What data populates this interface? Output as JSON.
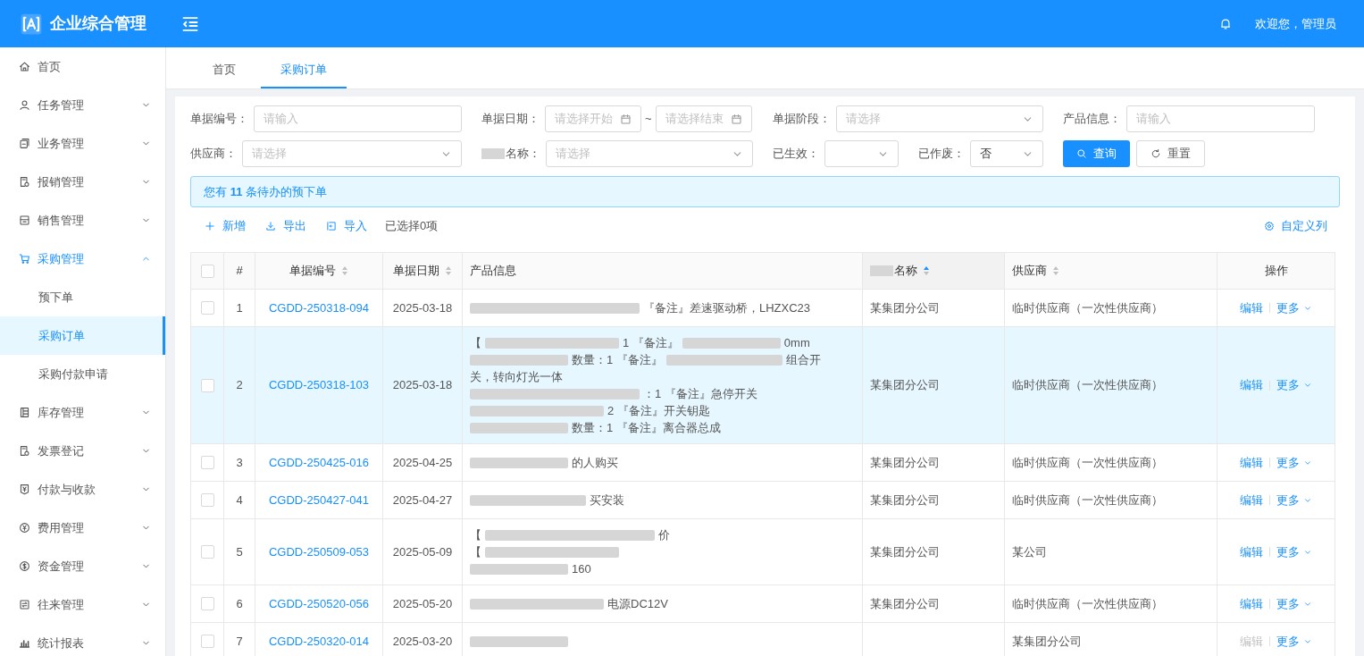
{
  "header": {
    "app_title": "企业综合管理",
    "user_greeting": "欢迎您，管理员"
  },
  "sidebar": {
    "items": [
      {
        "label": "首页",
        "selected": false
      },
      {
        "label": "任务管理",
        "expanded": false,
        "selected": false
      },
      {
        "label": "业务管理",
        "expanded": false,
        "selected": false
      },
      {
        "label": "报销管理",
        "expanded": false,
        "selected": false
      },
      {
        "label": "销售管理",
        "expanded": false,
        "selected": false
      },
      {
        "label": "采购管理",
        "expanded": true,
        "selected": true,
        "children": [
          {
            "label": "预下单",
            "selected": false
          },
          {
            "label": "采购订单",
            "selected": true
          },
          {
            "label": "采购付款申请",
            "selected": false
          }
        ]
      },
      {
        "label": "库存管理",
        "expanded": false,
        "selected": false
      },
      {
        "label": "发票登记",
        "expanded": false,
        "selected": false
      },
      {
        "label": "付款与收款",
        "expanded": false,
        "selected": false
      },
      {
        "label": "费用管理",
        "expanded": false,
        "selected": false
      },
      {
        "label": "资金管理",
        "expanded": false,
        "selected": false
      },
      {
        "label": "往来管理",
        "expanded": false,
        "selected": false
      },
      {
        "label": "统计报表",
        "expanded": false,
        "selected": false
      }
    ]
  },
  "tabs": [
    {
      "label": "首页",
      "selected": false
    },
    {
      "label": "采购订单",
      "selected": true
    }
  ],
  "filters": [
    {
      "kind": "input",
      "label": "单据编号：",
      "placeholder": "请输入"
    },
    {
      "kind": "daterange",
      "label": "单据日期：",
      "placeholder": "请选择开始",
      "separator": "~",
      "placeholder_end": "请选择结束"
    },
    {
      "kind": "select",
      "label": "单据阶段：",
      "placeholder": "请选择"
    },
    {
      "kind": "input",
      "label": "产品信息：",
      "placeholder": "请输入"
    },
    {
      "kind": "select",
      "label": "供应商：",
      "placeholder": "请选择"
    },
    {
      "kind": "select",
      "label": "名称：",
      "label_redacted_prefix": true,
      "placeholder": "请选择"
    },
    {
      "kind": "select-small",
      "label": "已生效："
    },
    {
      "kind": "select-small",
      "label": "已作废：",
      "value": "否"
    }
  ],
  "filter_buttons": [
    {
      "kind": "primary",
      "label": "查询"
    },
    {
      "kind": "default",
      "label": "重置"
    }
  ],
  "alert": {
    "text": "您有 **11** 条待办的预下单"
  },
  "toolbar": {
    "actions": [
      {
        "label": "新增"
      },
      {
        "label": "导出"
      },
      {
        "label": "导入"
      }
    ],
    "selection_count": "已选择0项",
    "customize": "自定义列"
  },
  "table": {
    "columns": [
      {
        "kind": "checkbox",
        "checked": false
      },
      {
        "kind": "index",
        "label": "#"
      },
      {
        "kind": "code",
        "label": "单据编号",
        "sorted": false
      },
      {
        "kind": "date",
        "label": "单据日期",
        "sorted": false
      },
      {
        "kind": "product",
        "label": "产品信息"
      },
      {
        "kind": "company",
        "label": "名称",
        "label_redacted_prefix": true,
        "sorted": true
      },
      {
        "kind": "supplier",
        "label": "供应商",
        "sorted": false
      },
      {
        "kind": "actions",
        "label": "操作"
      }
    ],
    "rows": [
      {
        "index": "1",
        "code": "CGDD-250318-094",
        "date": "2025-03-18",
        "selected": false,
        "checked": false,
        "product": [
          [
            {
              "kind": "blur"
            },
            {
              "kind": "text",
              "text": "『备注』差速驱动桥，LHZXC23"
            }
          ]
        ],
        "company": "某集团分公司",
        "supplier": "临时供应商（一次性供应商）",
        "edit": "编辑",
        "edit_disabled": false,
        "more": "更多"
      },
      {
        "index": "2",
        "code": "CGDD-250318-103",
        "date": "2025-03-18",
        "selected": true,
        "checked": false,
        "product": [
          [
            {
              "kind": "text",
              "text": "【"
            },
            {
              "kind": "blur"
            },
            {
              "kind": "text",
              "text": "1 『备注』"
            },
            {
              "kind": "blur"
            },
            {
              "kind": "text",
              "text": "0mm"
            }
          ],
          [
            {
              "kind": "blur"
            },
            {
              "kind": "text",
              "text": "数量：1 『备注』"
            },
            {
              "kind": "blur"
            },
            {
              "kind": "text",
              "text": "组合开"
            }
          ],
          [
            {
              "kind": "text",
              "text": "关，转向灯光一体"
            }
          ],
          [
            {
              "kind": "blur"
            },
            {
              "kind": "text",
              "text": "：1 『备注』急停开关"
            }
          ],
          [
            {
              "kind": "blur"
            },
            {
              "kind": "text",
              "text": "2 『备注』开关钥匙"
            }
          ],
          [
            {
              "kind": "blur"
            },
            {
              "kind": "text",
              "text": "数量：1 『备注』离合器总成"
            }
          ]
        ],
        "company": "某集团分公司",
        "supplier": "临时供应商（一次性供应商）",
        "edit": "编辑",
        "edit_disabled": false,
        "more": "更多"
      },
      {
        "index": "3",
        "code": "CGDD-250425-016",
        "date": "2025-04-25",
        "selected": false,
        "checked": false,
        "product": [
          [
            {
              "kind": "blur"
            },
            {
              "kind": "text",
              "text": "的人购买"
            }
          ]
        ],
        "company": "某集团分公司",
        "supplier": "临时供应商（一次性供应商）",
        "edit": "编辑",
        "edit_disabled": false,
        "more": "更多"
      },
      {
        "index": "4",
        "code": "CGDD-250427-041",
        "date": "2025-04-27",
        "selected": false,
        "checked": false,
        "product": [
          [
            {
              "kind": "blur"
            },
            {
              "kind": "text",
              "text": "买安装"
            }
          ]
        ],
        "company": "某集团分公司",
        "supplier": "临时供应商（一次性供应商）",
        "edit": "编辑",
        "edit_disabled": false,
        "more": "更多"
      },
      {
        "index": "5",
        "code": "CGDD-250509-053",
        "date": "2025-05-09",
        "selected": false,
        "checked": false,
        "product": [
          [
            {
              "kind": "text",
              "text": "【"
            },
            {
              "kind": "blur"
            },
            {
              "kind": "text",
              "text": "价"
            }
          ],
          [
            {
              "kind": "text",
              "text": "【"
            },
            {
              "kind": "blur"
            }
          ],
          [
            {
              "kind": "blur"
            },
            {
              "kind": "text",
              "text": "160"
            }
          ]
        ],
        "company": "某集团分公司",
        "supplier": "某公司",
        "edit": "编辑",
        "edit_disabled": false,
        "more": "更多"
      },
      {
        "index": "6",
        "code": "CGDD-250520-056",
        "date": "2025-05-20",
        "selected": false,
        "checked": false,
        "product": [
          [
            {
              "kind": "blur"
            },
            {
              "kind": "text",
              "text": "电源DC12V"
            }
          ]
        ],
        "company": "某集团分公司",
        "supplier": "临时供应商（一次性供应商）",
        "edit": "编辑",
        "edit_disabled": false,
        "more": "更多"
      },
      {
        "index": "7",
        "code": "CGDD-250320-014",
        "date": "2025-03-20",
        "selected": false,
        "checked": false,
        "product": [
          [
            {
              "kind": "blur"
            }
          ]
        ],
        "supplier": "某集团分公司",
        "edit": "编辑",
        "edit_disabled": true,
        "more": "更多"
      }
    ]
  }
}
